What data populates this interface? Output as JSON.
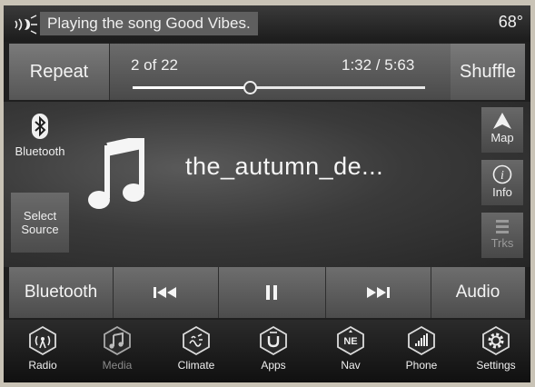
{
  "status_bar": {
    "message": "Playing the song Good Vibes.",
    "temperature": "68°"
  },
  "controls": {
    "repeat_label": "Repeat",
    "shuffle_label": "Shuffle",
    "track_position": "2 of 22",
    "elapsed_total": "1:32 / 5:63",
    "progress_fraction": 0.4
  },
  "now_playing": {
    "source_indicator": "Bluetooth",
    "select_source_line1": "Select",
    "select_source_line2": "Source",
    "song_title": "the_autumn_de..."
  },
  "side_buttons": {
    "map_label": "Map",
    "info_label": "Info",
    "tracks_label": "Trks"
  },
  "transport": {
    "bluetooth_label": "Bluetooth",
    "audio_label": "Audio"
  },
  "bottom_nav": {
    "items": [
      {
        "label": "Radio",
        "icon": "radio-icon"
      },
      {
        "label": "Media",
        "icon": "media-icon"
      },
      {
        "label": "Climate",
        "icon": "climate-icon"
      },
      {
        "label": "Apps",
        "icon": "apps-icon"
      },
      {
        "label": "Nav",
        "icon": "nav-compass-icon",
        "badge": "NE"
      },
      {
        "label": "Phone",
        "icon": "phone-icon"
      },
      {
        "label": "Settings",
        "icon": "settings-gear-icon"
      }
    ]
  },
  "colors": {
    "screen_bg": "#1f1f1f",
    "button_gradient_top": "#7a7a7a",
    "button_gradient_bottom": "#565656",
    "text": "#f4f4f4",
    "inactive_text": "#8a8a8a"
  }
}
